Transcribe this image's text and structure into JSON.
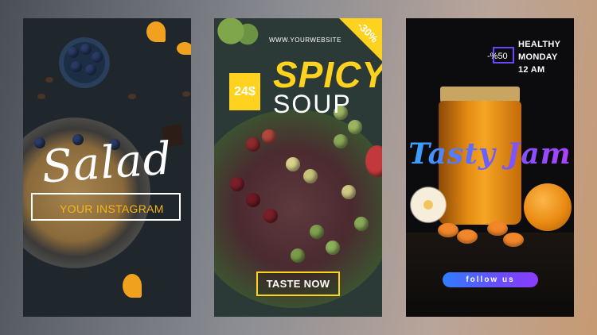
{
  "card1": {
    "title": "Salad",
    "instagram_label": "YOUR INSTAGRAM",
    "accent_color": "#f5b51a"
  },
  "card2": {
    "website": "WWW.YOURWEBSITE",
    "discount": "-30%",
    "price": "24$",
    "title_line1": "SPICY",
    "title_line2": "SOUP",
    "cta": "TASTE NOW",
    "accent_color": "#ffd21f"
  },
  "card3": {
    "discount": "-%50",
    "info_line1": "HEALTHY",
    "info_line2": "MONDAY",
    "info_line3": "12 AM",
    "title": "Tasty Jam",
    "cta": "follow us",
    "accent_color": "#6b45ff"
  }
}
